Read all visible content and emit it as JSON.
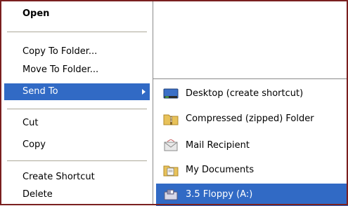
{
  "context_menu": {
    "items": [
      {
        "label": "Open"
      },
      {
        "label": "Copy To Folder..."
      },
      {
        "label": "Move To Folder..."
      },
      {
        "label": "Send To"
      },
      {
        "label": "Cut"
      },
      {
        "label": "Copy"
      },
      {
        "label": "Create Shortcut"
      },
      {
        "label": "Delete"
      }
    ]
  },
  "send_to_menu": {
    "items": [
      {
        "label": "Desktop (create shortcut)",
        "icon": "desktop-icon"
      },
      {
        "label": "Compressed (zipped) Folder",
        "icon": "zip-folder-icon"
      },
      {
        "label": "Mail Recipient",
        "icon": "mail-icon"
      },
      {
        "label": "My Documents",
        "icon": "documents-folder-icon"
      },
      {
        "label": "3.5 Floppy (A:)",
        "icon": "floppy-drive-icon"
      }
    ]
  },
  "colors": {
    "selection": "#316ac5",
    "frame_border": "#7a1f1f",
    "separator": "#aca899"
  }
}
